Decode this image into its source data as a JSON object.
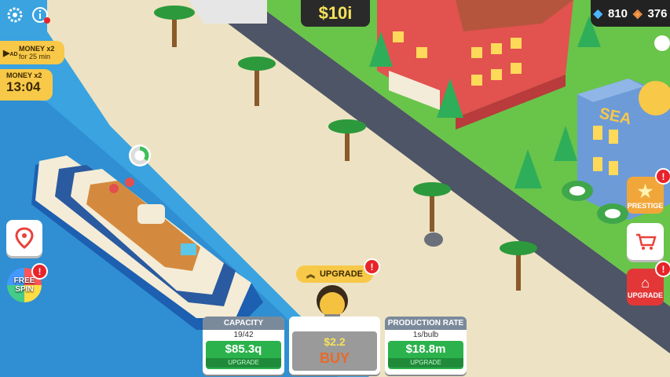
{
  "hud": {
    "money": "$10i",
    "gems": "810",
    "tickets": "376",
    "ad_boost": {
      "title": "MONEY x2",
      "subtitle": "for 25 min",
      "ad_label": "AD"
    },
    "boost_timer": {
      "title": "MONEY x2",
      "time": "13:04"
    },
    "free_spin": {
      "line1": "FREE",
      "line2": "SPIN"
    },
    "prestige_label": "PRESTIGE",
    "upgrade_side_label": "UPGRADE",
    "alert_mark": "!"
  },
  "bottom": {
    "upgrade_pill": "UPGRADE",
    "capacity": {
      "title": "CAPACITY",
      "value": "19/42",
      "cost": "$85.3q",
      "action": "UPGRADE"
    },
    "buy": {
      "price": "$2.2",
      "label": "BUY"
    },
    "production": {
      "title": "PRODUCTION RATE",
      "value": "1s/bulb",
      "cost": "$18.8m",
      "action": "UPGRADE"
    }
  },
  "scene": {
    "hotel_sign": "SEA",
    "progress_ring": 0.35
  },
  "colors": {
    "sea": "#3aa3e0",
    "sand": "#ede3c4",
    "grass": "#69c44a",
    "road": "#4d5566",
    "accent": "#f8c848"
  }
}
